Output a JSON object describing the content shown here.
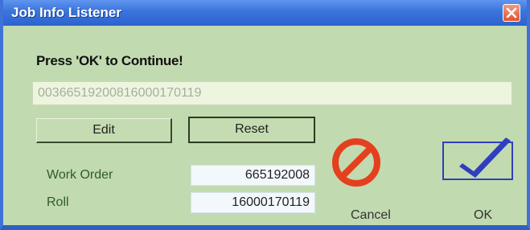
{
  "window": {
    "title": "Job Info Listener",
    "close_icon": "close-icon"
  },
  "main": {
    "prompt": "Press 'OK' to Continue!",
    "job_value": "00366519200816000170119",
    "edit_label": "Edit",
    "reset_label": "Reset",
    "work_order_label": "Work Order",
    "work_order_value": "665192008",
    "roll_label": "Roll",
    "roll_value": "16000170119",
    "cancel_label": "Cancel",
    "cancel_icon": "cancel-icon",
    "ok_label": "OK",
    "ok_icon": "checkmark-icon"
  },
  "colors": {
    "titlebar": "#3a74db",
    "window_bg": "#c2dab0",
    "cancel_red": "#e4401f",
    "ok_blue": "#2f3fbf"
  }
}
